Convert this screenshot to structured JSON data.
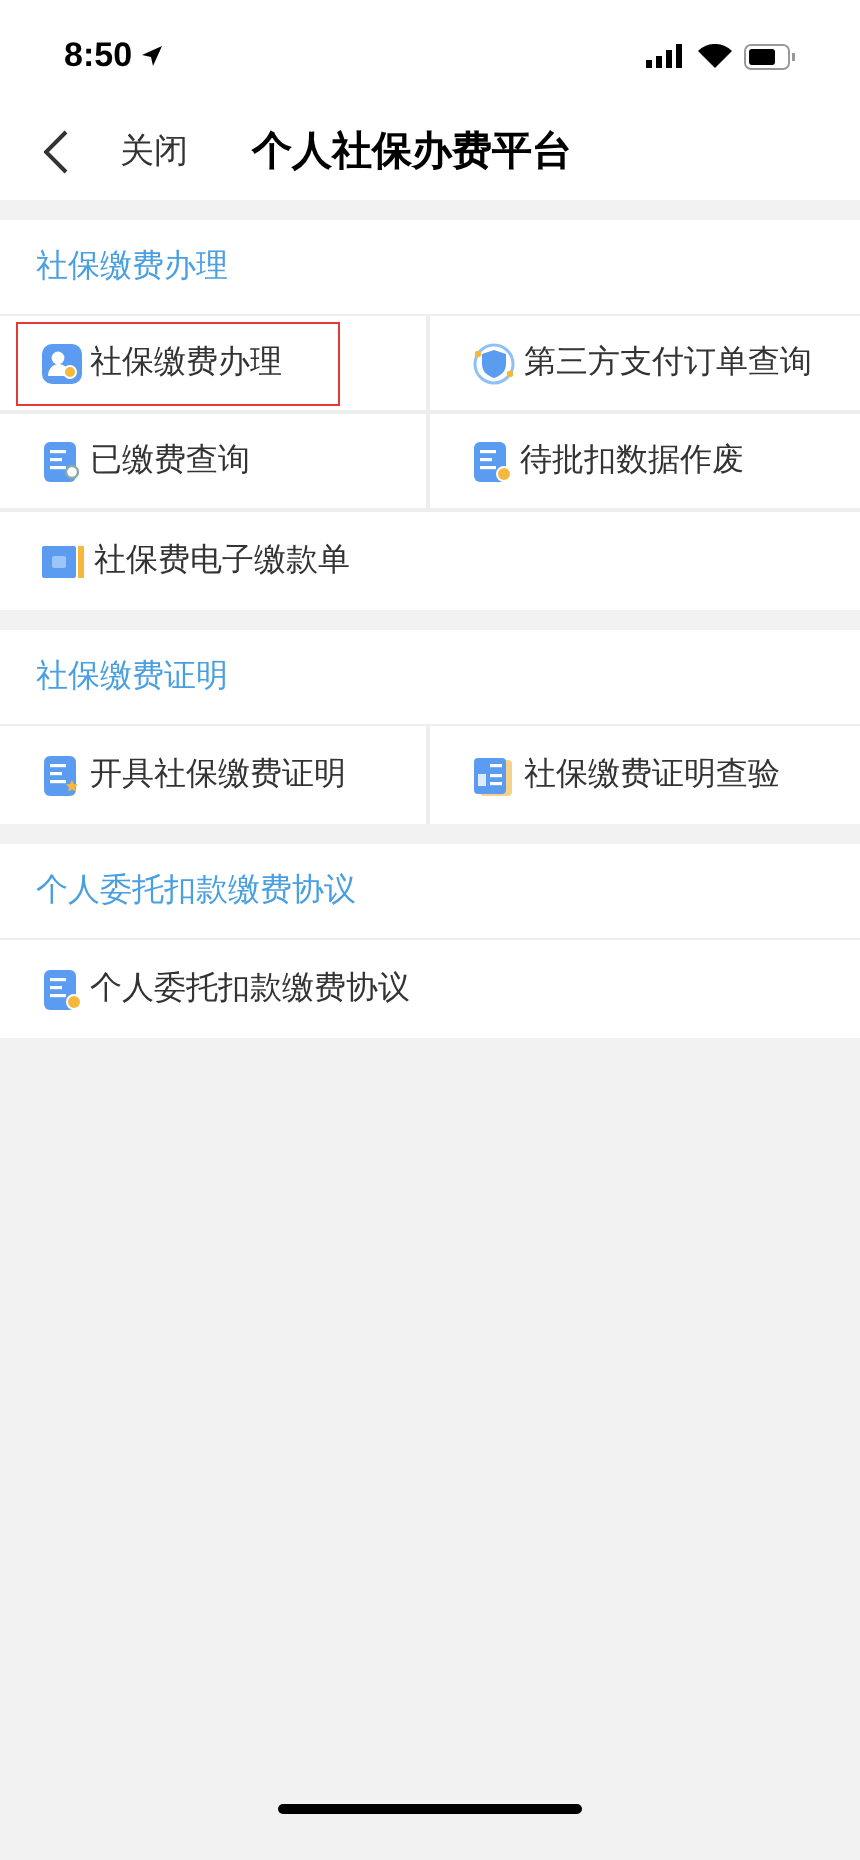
{
  "status_bar": {
    "time": "8:50"
  },
  "nav": {
    "back_label": "关闭",
    "title": "个人社保办费平台"
  },
  "sections": [
    {
      "title": "社保缴费办理",
      "items": [
        {
          "label": "社保缴费办理",
          "kind": "person",
          "highlighted": true
        },
        {
          "label": "第三方支付订单查询",
          "kind": "shield",
          "highlighted": false
        },
        {
          "label": "已缴费查询",
          "kind": "search",
          "highlighted": false
        },
        {
          "label": "待批扣数据作废",
          "kind": "cancel",
          "highlighted": false
        },
        {
          "label": "社保费电子缴款单",
          "kind": "ticket",
          "highlighted": false
        }
      ]
    },
    {
      "title": "社保缴费证明",
      "items": [
        {
          "label": "开具社保缴费证明",
          "kind": "star",
          "highlighted": false
        },
        {
          "label": "社保缴费证明查验",
          "kind": "money",
          "highlighted": false
        }
      ]
    },
    {
      "title": "个人委托扣款缴费协议",
      "items": [
        {
          "label": "个人委托扣款缴费协议",
          "kind": "coin",
          "highlighted": false
        }
      ]
    }
  ]
}
